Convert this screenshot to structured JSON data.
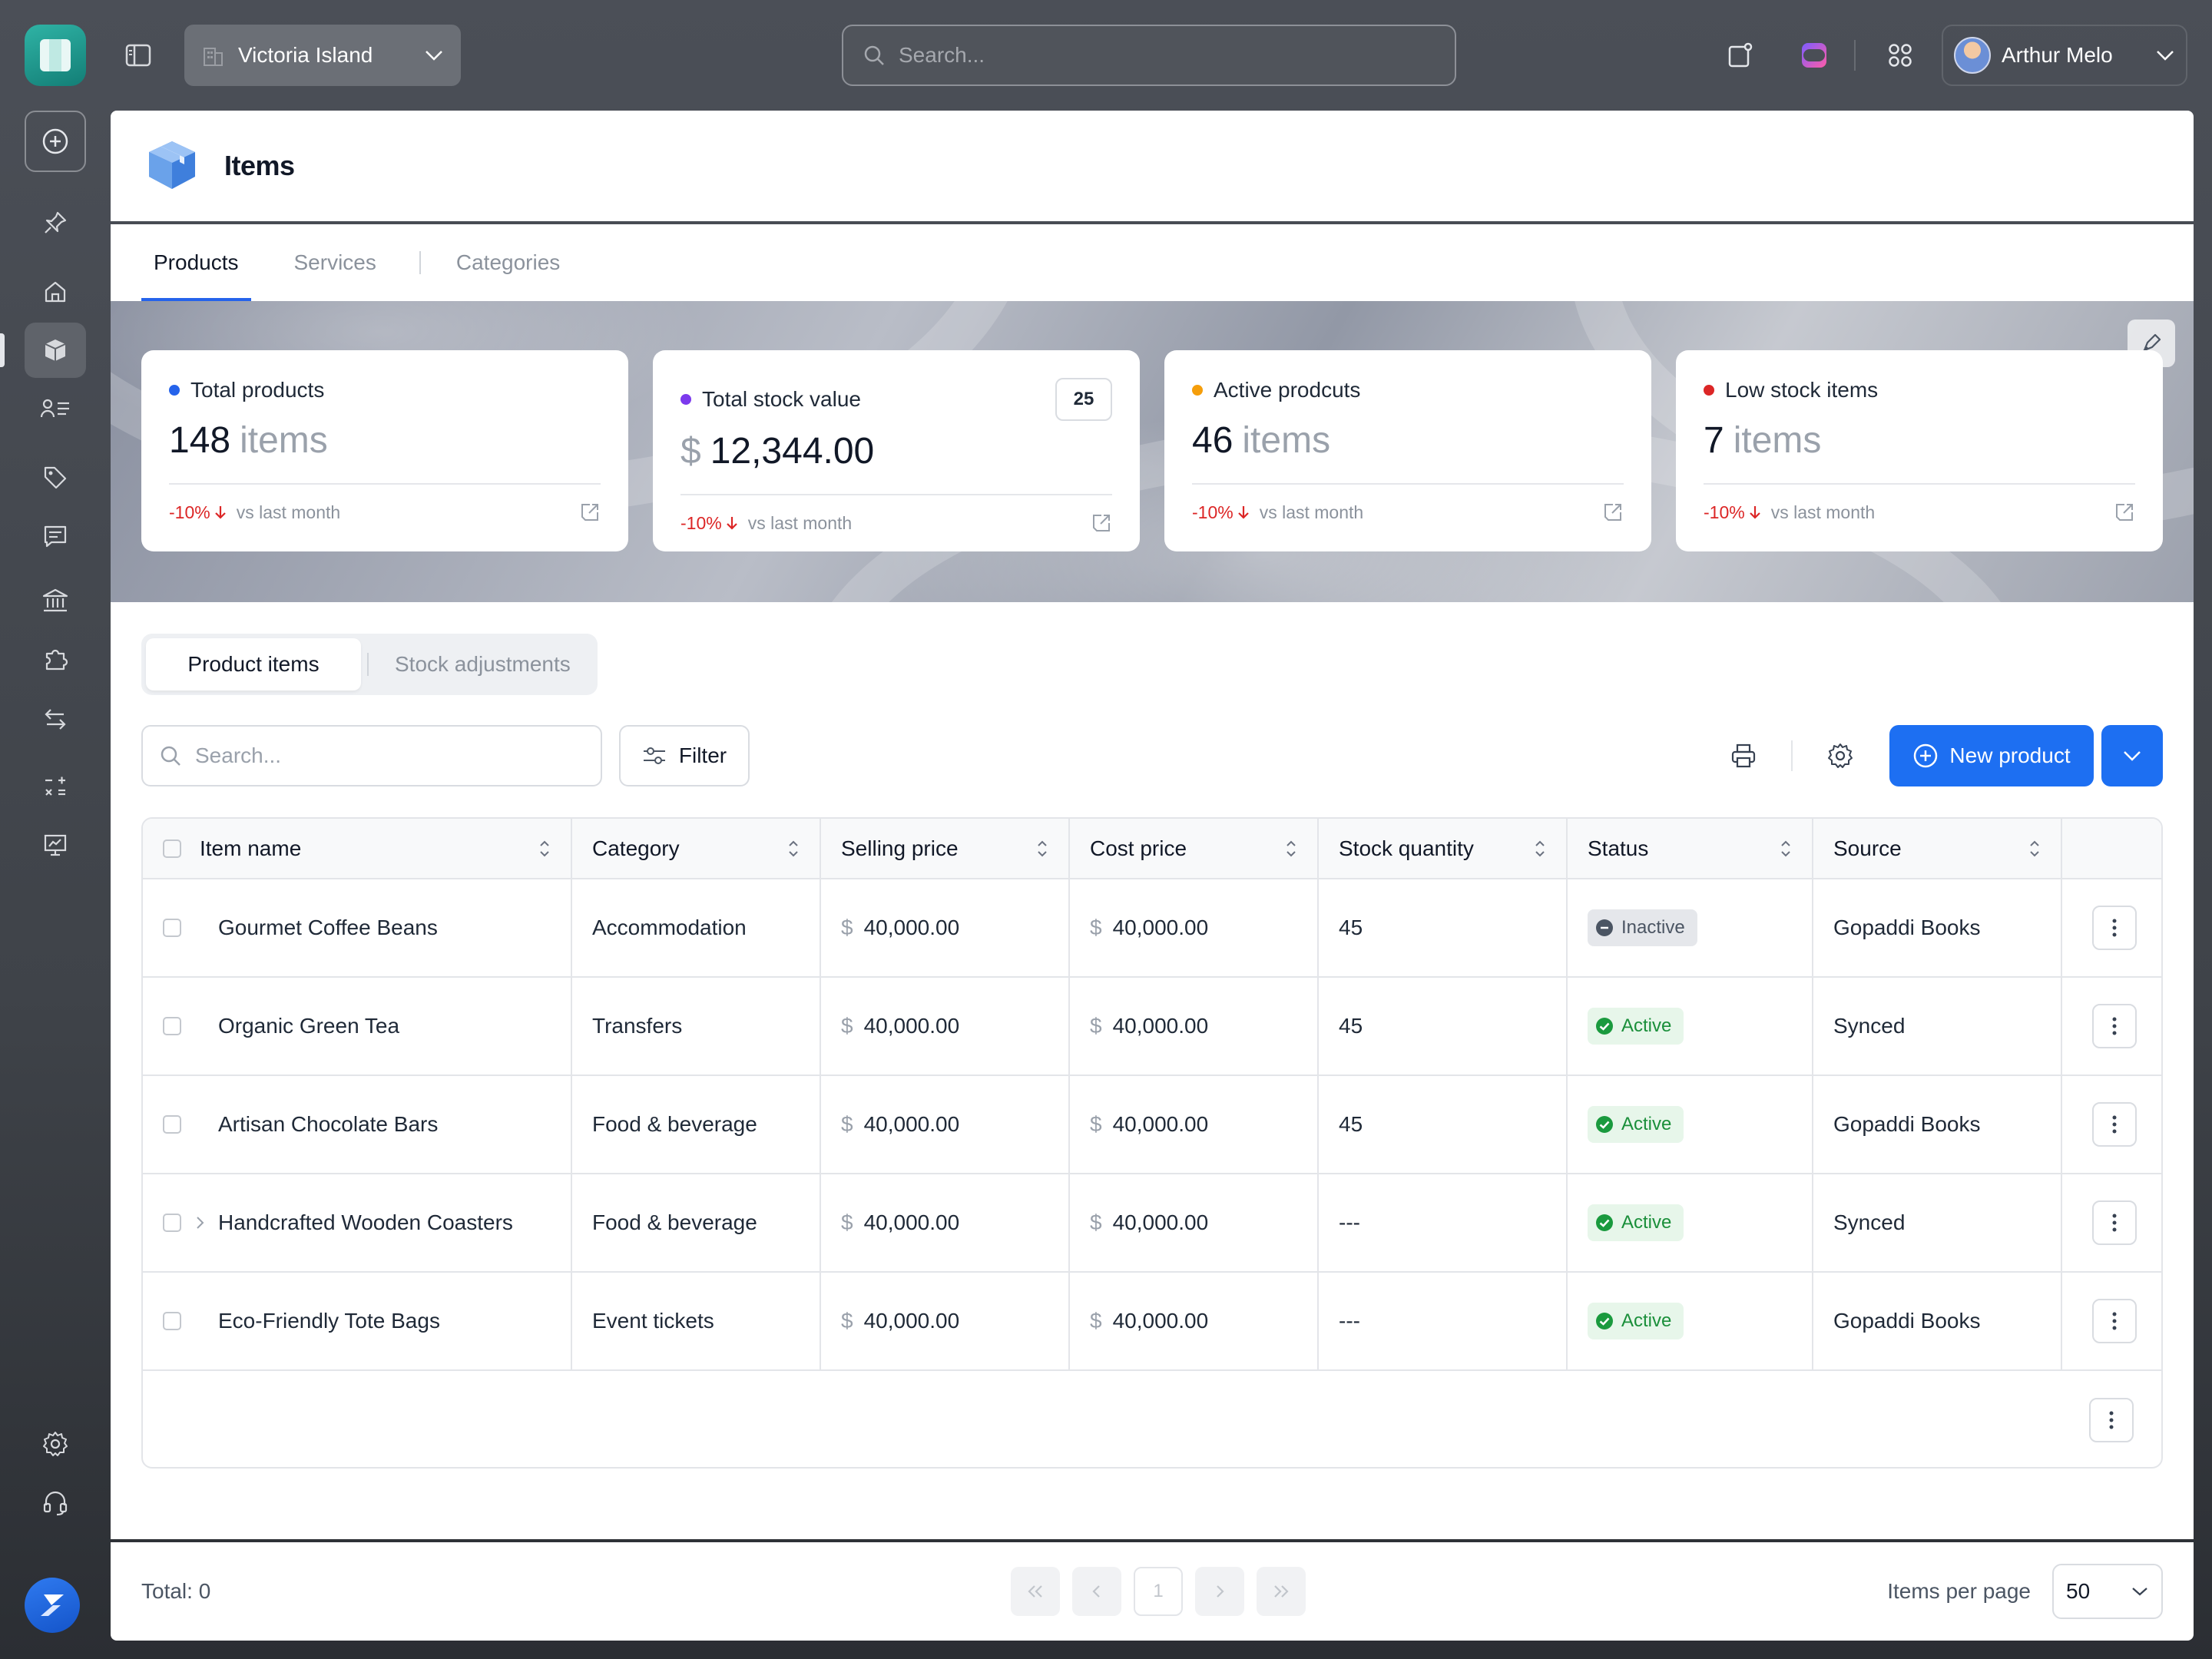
{
  "topbar": {
    "location": "Victoria Island",
    "search_placeholder": "Search...",
    "user_name": "Arthur Melo"
  },
  "page": {
    "title": "Items"
  },
  "tabs": [
    {
      "label": "Products",
      "active": true
    },
    {
      "label": "Services",
      "active": false
    },
    {
      "label": "Categories",
      "active": false
    }
  ],
  "stats": [
    {
      "label": "Total products",
      "value": "148",
      "unit": "items",
      "prefix": "",
      "badge": "",
      "dot": "#2563eb",
      "change": "-10%",
      "compare": "vs last month"
    },
    {
      "label": "Total stock value",
      "value": "12,344.00",
      "unit": "",
      "prefix": "$",
      "badge": "25",
      "dot": "#7c3aed",
      "change": "-10%",
      "compare": "vs last month"
    },
    {
      "label": "Active prodcuts",
      "value": "46",
      "unit": "items",
      "prefix": "",
      "badge": "",
      "dot": "#f59e0b",
      "change": "-10%",
      "compare": "vs last month"
    },
    {
      "label": "Low stock items",
      "value": "7",
      "unit": "items",
      "prefix": "",
      "badge": "",
      "dot": "#dc2626",
      "change": "-10%",
      "compare": "vs last month"
    }
  ],
  "segment": {
    "active": "Product items",
    "other": "Stock adjustments"
  },
  "toolbar": {
    "search_placeholder": "Search...",
    "filter_label": "Filter",
    "new_label": "New product"
  },
  "table": {
    "columns": [
      "Item name",
      "Category",
      "Selling price",
      "Cost price",
      "Stock quantity",
      "Status",
      "Source"
    ],
    "currency": "$",
    "rows": [
      {
        "name": "Gourmet Coffee Beans",
        "category": "Accommodation",
        "selling": "40,000.00",
        "cost": "40,000.00",
        "qty": "45",
        "status": "Inactive",
        "source": "Gopaddi Books",
        "expandable": false
      },
      {
        "name": "Organic Green Tea",
        "category": "Transfers",
        "selling": "40,000.00",
        "cost": "40,000.00",
        "qty": "45",
        "status": "Active",
        "source": "Synced",
        "expandable": false
      },
      {
        "name": "Artisan Chocolate Bars",
        "category": "Food & beverage",
        "selling": "40,000.00",
        "cost": "40,000.00",
        "qty": "45",
        "status": "Active",
        "source": "Gopaddi Books",
        "expandable": false
      },
      {
        "name": "Handcrafted Wooden Coasters",
        "category": "Food & beverage",
        "selling": "40,000.00",
        "cost": "40,000.00",
        "qty": "---",
        "status": "Active",
        "source": "Synced",
        "expandable": true
      },
      {
        "name": "Eco-Friendly Tote Bags",
        "category": "Event tickets",
        "selling": "40,000.00",
        "cost": "40,000.00",
        "qty": "---",
        "status": "Active",
        "source": "Gopaddi Books",
        "expandable": false
      }
    ]
  },
  "footer": {
    "total": "Total: 0",
    "page": "1",
    "per_page_label": "Items per page",
    "per_page_value": "50"
  },
  "colors": {
    "accent": "#1d6ff2",
    "active_green": "#1a8f3a",
    "negative_red": "#dc2626"
  }
}
